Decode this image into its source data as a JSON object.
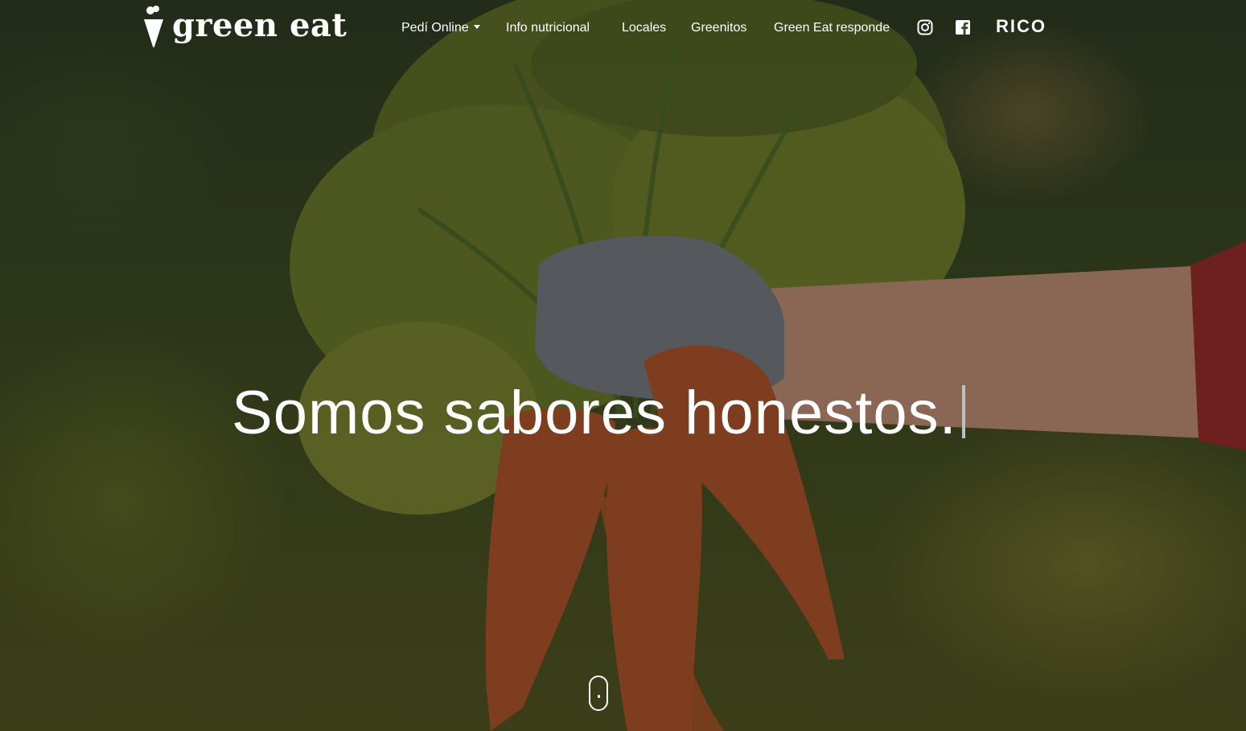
{
  "brand": {
    "name": "green eat",
    "logo_icon": "carrot-icon"
  },
  "nav": {
    "items": [
      {
        "label": "Pedí Online",
        "has_dropdown": true
      },
      {
        "label": "Info nutricional"
      },
      {
        "label": "Locales"
      },
      {
        "label": "Greenitos"
      },
      {
        "label": "Green Eat responde"
      }
    ],
    "social": [
      {
        "icon": "instagram-icon"
      },
      {
        "icon": "facebook-icon"
      }
    ],
    "partner": {
      "label": "RICO"
    }
  },
  "hero": {
    "headline": "Somos sabores honestos.",
    "scroll_indicator_icon": "mouse-scroll-icon"
  }
}
